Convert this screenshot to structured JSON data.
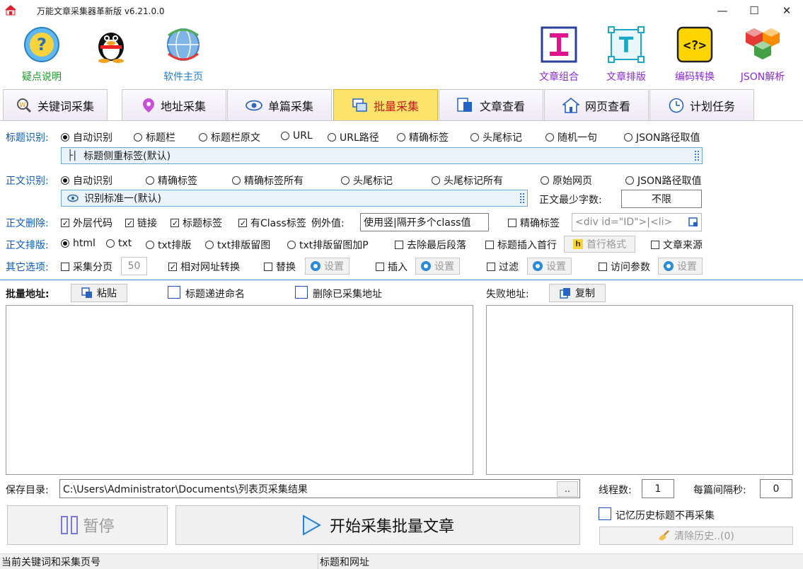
{
  "window": {
    "title": "万能文章采集器革新版 v6.21.0.0",
    "controls": [
      "minimize-icon",
      "maximize-icon",
      "close-icon"
    ]
  },
  "toolbar": {
    "left": [
      {
        "label": "疑点说明",
        "icon": "help-icon",
        "color": "#1f9a2b"
      },
      {
        "label": "",
        "icon": "qq-penguin-icon"
      },
      {
        "label": "软件主页",
        "icon": "globe-icon",
        "color": "#1d7fd0"
      }
    ],
    "right": [
      {
        "label": "文章组合",
        "icon": "article-combine-icon",
        "color": "#8a2bd6"
      },
      {
        "label": "文章排版",
        "icon": "article-layout-icon",
        "color": "#8a2bd6"
      },
      {
        "label": "编码转换",
        "icon": "encode-convert-icon",
        "color": "#8a2bd6"
      },
      {
        "label": "JSON解析",
        "icon": "json-parse-icon",
        "color": "#8a2bd6"
      }
    ]
  },
  "tabs": [
    {
      "label": "关键词采集",
      "icon": "keyword-search-icon",
      "active": false
    },
    {
      "label": "地址采集",
      "icon": "location-pin-icon",
      "active": false
    },
    {
      "label": "单篇采集",
      "icon": "eye-icon",
      "active": false
    },
    {
      "label": "批量采集",
      "icon": "batch-windows-icon",
      "active": true
    },
    {
      "label": "文章查看",
      "icon": "article-view-icon",
      "active": false
    },
    {
      "label": "网页查看",
      "icon": "home-page-icon",
      "active": false
    },
    {
      "label": "计划任务",
      "icon": "clock-icon",
      "active": false
    }
  ],
  "title_detect": {
    "label": "标题识别:",
    "options": [
      "自动识别",
      "标题栏",
      "标题栏原文",
      "URL",
      "URL路径",
      "精确标签",
      "头尾标记",
      "随机一句",
      "JSON路径取值"
    ],
    "selected": "自动识别",
    "combo_value": "标题侧重标签(默认)"
  },
  "body_detect": {
    "label": "正文识别:",
    "options": [
      "自动识别",
      "精确标签",
      "精确标签所有",
      "头尾标记",
      "头尾标记所有",
      "原始网页",
      "JSON路径取值"
    ],
    "selected": "自动识别",
    "combo_value": "识别标准一(默认)",
    "min_chars_label": "正文最少字数:",
    "min_chars_value": "不限"
  },
  "body_delete": {
    "label": "正文删除:",
    "checks": [
      {
        "label": "外层代码",
        "checked": true
      },
      {
        "label": "链接",
        "checked": true
      },
      {
        "label": "标题标签",
        "checked": true
      },
      {
        "label": "有Class标签",
        "checked": true
      }
    ],
    "exception_label": "例外值:",
    "exception_value": "使用竖|隔开多个class值",
    "precise_label": "精确标签",
    "precise_checked": false,
    "precise_placeholder": "<div id=\"ID\">|<li>"
  },
  "body_format": {
    "label": "正文排版:",
    "options": [
      "html",
      "txt",
      "txt排版",
      "txt排版留图",
      "txt排版留图加P"
    ],
    "selected": "html",
    "checks": [
      {
        "label": "去除最后段落",
        "checked": false
      },
      {
        "label": "标题插入首行",
        "checked": false
      },
      {
        "label": "文章来源",
        "checked": false
      }
    ],
    "first_line_button": "首行格式"
  },
  "other": {
    "label": "其它选项:",
    "paging_label": "采集分页",
    "paging_checked": false,
    "paging_value": "50",
    "relative_label": "相对网址转换",
    "relative_checked": true,
    "replace_label": "替换",
    "insert_label": "插入",
    "filter_label": "过滤",
    "params_label": "访问参数",
    "settings_label": "设置"
  },
  "batch": {
    "label": "批量地址:",
    "paste_button": "粘贴",
    "title_increment_label": "标题递进命名",
    "delete_collected_label": "删除已采集地址",
    "failed_label": "失败地址:",
    "copy_button": "复制"
  },
  "save": {
    "label": "保存目录:",
    "path": "C:\\Users\\Administrator\\Documents\\列表页采集结果",
    "browse": "..",
    "threads_label": "线程数:",
    "threads_value": "1",
    "interval_label": "每篇间隔秒:",
    "interval_value": "0"
  },
  "actions": {
    "pause": "暂停",
    "start": "开始采集批量文章",
    "remember_label": "记忆历史标题不再采集",
    "clear_history": "清除历史..(0)"
  },
  "statusbar": {
    "left": "当前关键词和采集页号",
    "right": "标题和网址"
  }
}
